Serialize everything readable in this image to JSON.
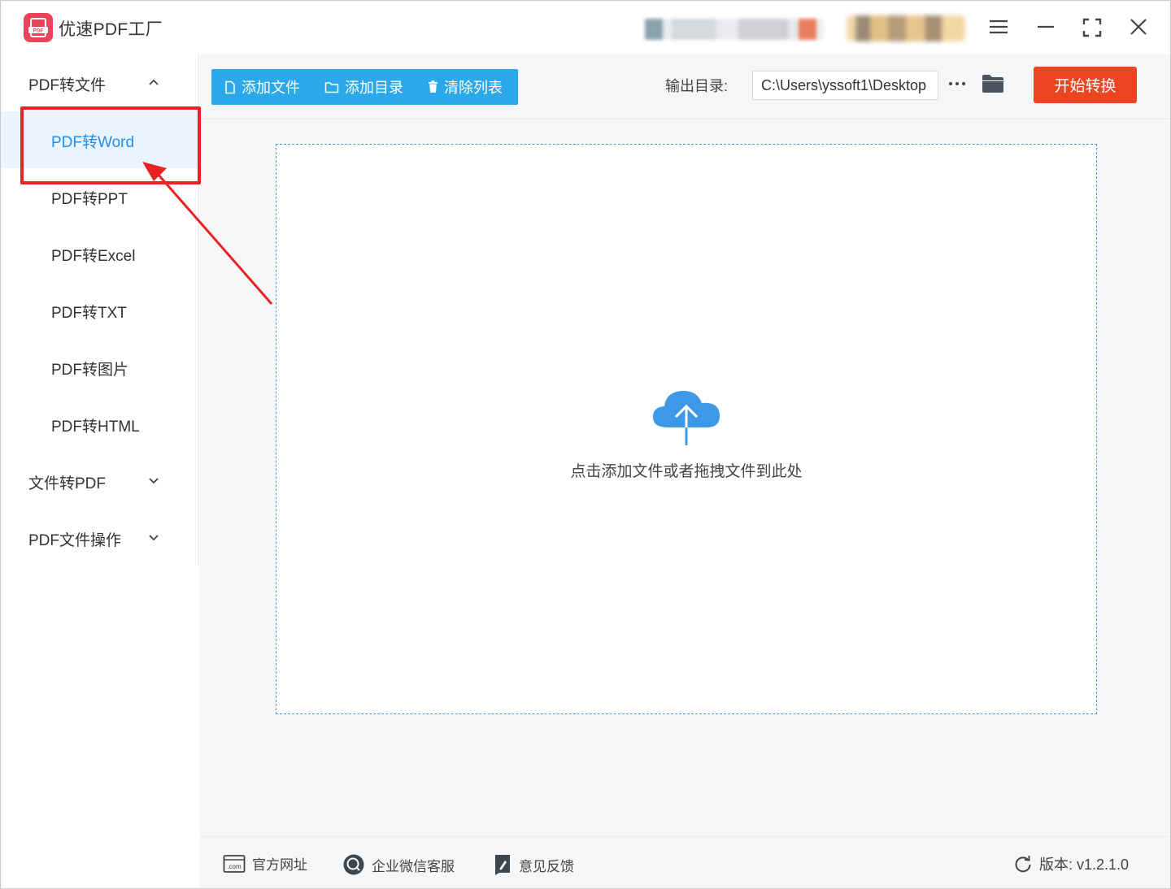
{
  "app": {
    "title": "优速PDF工厂",
    "logo_text": "PDF"
  },
  "window_controls": {
    "menu_icon": "hamburger-menu-icon",
    "minimize_icon": "minimize-icon",
    "maximize_icon": "fullscreen-icon",
    "close_icon": "close-icon"
  },
  "sidebar": {
    "groups": [
      {
        "label": "PDF转文件",
        "expanded": true,
        "items": [
          {
            "label": "PDF转Word",
            "active": true
          },
          {
            "label": "PDF转PPT"
          },
          {
            "label": "PDF转Excel"
          },
          {
            "label": "PDF转TXT"
          },
          {
            "label": "PDF转图片"
          },
          {
            "label": "PDF转HTML"
          }
        ]
      },
      {
        "label": "文件转PDF",
        "expanded": false
      },
      {
        "label": "PDF文件操作",
        "expanded": false
      }
    ]
  },
  "toolbar": {
    "add_file": "添加文件",
    "add_folder": "添加目录",
    "clear_list": "清除列表",
    "output_label": "输出目录:",
    "output_path": "C:\\Users\\yssoft1\\Desktop",
    "more_label": "···",
    "start": "开始转换"
  },
  "dropzone": {
    "hint": "点击添加文件或者拖拽文件到此处"
  },
  "footer": {
    "website": "官方网址",
    "wechat": "企业微信客服",
    "feedback": "意见反馈",
    "version": "版本:  v1.2.1.0"
  },
  "colors": {
    "accent_blue": "#2ba8ea",
    "active_text": "#1f8ff0",
    "start_button": "#eb4524",
    "logo": "#e8455a",
    "annotation_red": "#e82323"
  }
}
